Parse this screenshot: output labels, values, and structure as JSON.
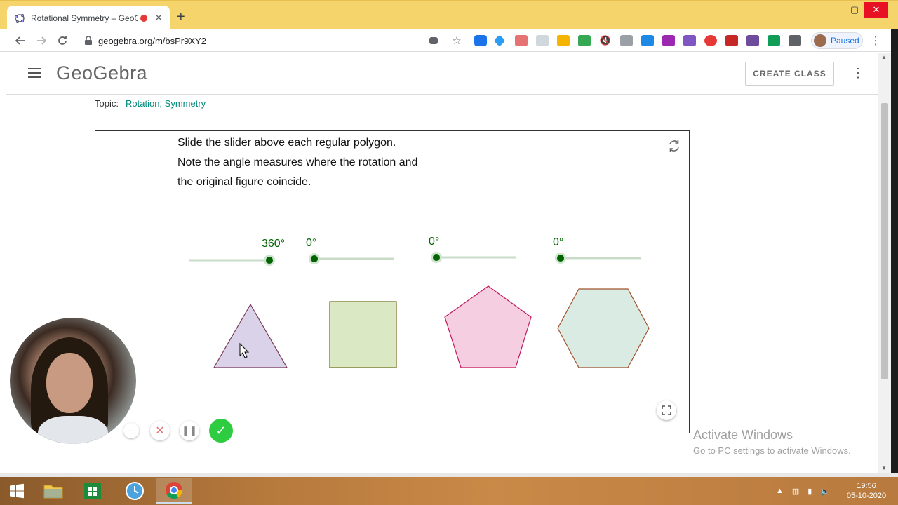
{
  "browser": {
    "tab_title": "Rotational Symmetry – GeoG",
    "tab_close": "✕",
    "new_tab": "+",
    "url": "geogebra.org/m/bsPr9XY2",
    "profile_status": "Paused",
    "window_controls": {
      "minimize": "–",
      "maximize": "▢",
      "close": "✕"
    }
  },
  "header": {
    "logo": "GeoGebra",
    "create_class_label": "CREATE CLASS"
  },
  "topic": {
    "label": "Topic:",
    "links": "Rotation, Symmetry"
  },
  "applet": {
    "instructions": [
      "Slide the slider above each regular polygon.",
      "Note the angle measures where the rotation and",
      "the original figure coincide."
    ],
    "sliders": [
      {
        "label": "360°",
        "value": 360,
        "max": 360,
        "shape": "triangle",
        "fill": "#d9d2e9",
        "stroke": "#7a3a57"
      },
      {
        "label": "0°",
        "value": 0,
        "max": 360,
        "shape": "square",
        "fill": "#dbe8c4",
        "stroke": "#6b6b1a"
      },
      {
        "label": "0°",
        "value": 0,
        "max": 360,
        "shape": "pentagon",
        "fill": "#f5cfe1",
        "stroke": "#c2185b"
      },
      {
        "label": "0°",
        "value": 0,
        "max": 360,
        "shape": "hexagon",
        "fill": "#d9ebe3",
        "stroke": "#a0522d"
      }
    ],
    "slider_color": "#006400"
  },
  "recording": {
    "more": "···",
    "cancel": "✕",
    "pause": "❚❚",
    "done": "✓"
  },
  "watermark": {
    "line1": "Activate Windows",
    "line2": "Go to PC settings to activate Windows."
  },
  "taskbar": {
    "time": "19:56",
    "date": "05-10-2020"
  }
}
